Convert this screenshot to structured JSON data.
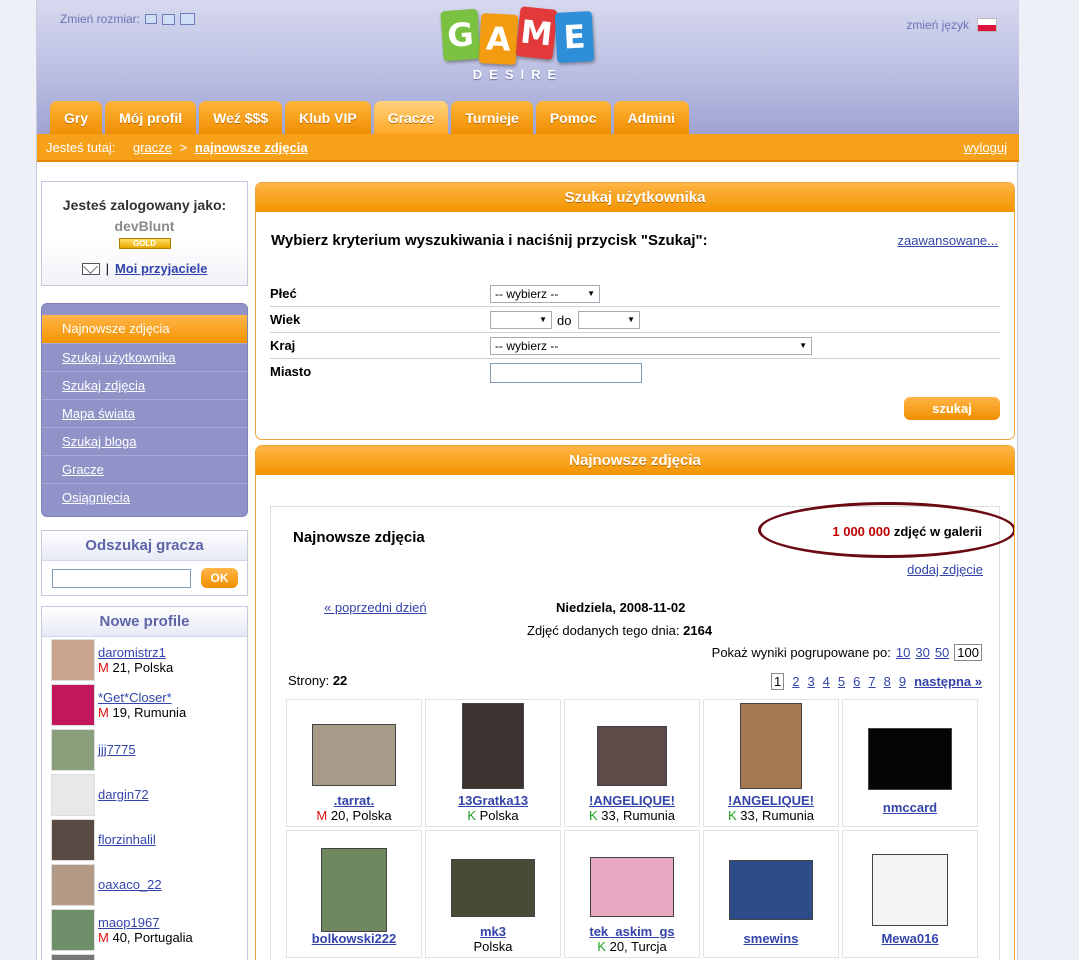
{
  "header": {
    "resize_label": "Zmień rozmiar:",
    "lang_label": "zmień język",
    "logo_letters": [
      "G",
      "A",
      "M",
      "E"
    ],
    "logo_colors": [
      "#7ac142",
      "#f39c12",
      "#e23a3a",
      "#2e8fd8"
    ],
    "logo_sub": "DESIRE"
  },
  "nav": {
    "tabs": [
      {
        "label": "Gry"
      },
      {
        "label": "Mój profil"
      },
      {
        "label": "Weź $$$"
      },
      {
        "label": "Klub VIP"
      },
      {
        "label": "Gracze",
        "active": true
      },
      {
        "label": "Turnieje"
      },
      {
        "label": "Pomoc"
      },
      {
        "label": "Admini"
      }
    ]
  },
  "breadcrumb": {
    "prefix": "Jesteś tutaj:",
    "parent": "gracze",
    "separator": ">",
    "current": "najnowsze zdjęcia",
    "logout": "wyloguj"
  },
  "login": {
    "label": "Jesteś zalogowany jako:",
    "nick": "devBlunt",
    "badge": "GOLD",
    "divider": "|",
    "friends": "Moi przyjaciele"
  },
  "menu": {
    "items": [
      {
        "label": "Najnowsze zdjęcia",
        "active": true
      },
      {
        "label": "Szukaj użytkownika"
      },
      {
        "label": "Szukaj zdjęcia"
      },
      {
        "label": "Mapa świata"
      },
      {
        "label": "Szukaj bloga"
      },
      {
        "label": "Gracze"
      },
      {
        "label": "Osiągnięcia"
      }
    ]
  },
  "find": {
    "title": "Odszukaj gracza",
    "value": "",
    "button": "OK"
  },
  "new_profiles": {
    "title": "Nowe profile",
    "items": [
      {
        "name": "daromistrz1",
        "sex": "M",
        "info": "21, Polska",
        "avatar_color": "#c9a38c"
      },
      {
        "name": "*Get*Closer*",
        "sex": "M",
        "info": "19, Rumunia",
        "avatar_color": "#c2185b"
      },
      {
        "name": "jjj7775",
        "sex": "",
        "info": "",
        "avatar_color": "#8aa07c"
      },
      {
        "name": "dargin72",
        "sex": "",
        "info": "",
        "avatar_color": "#e8e8e8"
      },
      {
        "name": "florzinhalil",
        "sex": "",
        "info": "",
        "avatar_color": "#5a4a44"
      },
      {
        "name": "oaxaco_22",
        "sex": "",
        "info": "",
        "avatar_color": "#b29a86"
      },
      {
        "name": "maop1967",
        "sex": "M",
        "info": "40, Portugalia",
        "avatar_color": "#6f8f6a"
      },
      {
        "name": "",
        "sex": "",
        "info": "",
        "avatar_color": "#777777"
      }
    ]
  },
  "search": {
    "header": "Szukaj użytkownika",
    "title": "Wybierz kryterium wyszukiwania i naciśnij przycisk \"Szukaj\":",
    "advanced": "zaawansowane...",
    "gender_label": "Płeć",
    "gender_value": "-- wybierz --",
    "age_label": "Wiek",
    "age_from": "",
    "age_to_label": "do",
    "age_to": "",
    "country_label": "Kraj",
    "country_value": "-- wybierz --",
    "city_label": "Miasto",
    "city_value": "",
    "button": "szukaj"
  },
  "photos": {
    "header": "Najnowsze zdjęcia",
    "title": "Najnowsze zdjęcia",
    "count_number": "1 000 000",
    "count_suffix": "zdjęć w galerii",
    "add_link": "dodaj zdjęcie",
    "prev_day": "« poprzedni dzień",
    "date": "Niedziela, 2008-11-02",
    "added_label": "Zdjęć dodanych tego dnia:",
    "added_value": "2164",
    "group_label": "Pokaż wyniki pogrupowane po:",
    "group_options": [
      "10",
      "30",
      "50"
    ],
    "group_selected": "100",
    "pages_label": "Strony:",
    "pages_total": "22",
    "page_current": "1",
    "page_links": [
      "2",
      "3",
      "4",
      "5",
      "6",
      "7",
      "8",
      "9"
    ],
    "next": "następna »",
    "items": [
      {
        "name": ".tarrat.",
        "sex": "M",
        "info": "20, Polska",
        "color": "#a89a88"
      },
      {
        "name": "13Gratka13",
        "sex": "K",
        "info": "Polska",
        "color": "#3d3432"
      },
      {
        "name": "!ANGELIQUE!",
        "sex": "K",
        "info": "33, Rumunia",
        "color": "#5e4a48"
      },
      {
        "name": "!ANGELIQUE!",
        "sex": "K",
        "info": "33, Rumunia",
        "color": "#a47a52"
      },
      {
        "name": "nmccard",
        "sex": "",
        "info": "",
        "color": "#050505"
      },
      {
        "name": "bolkowski222",
        "sex": "",
        "info": "",
        "color": "#708860"
      },
      {
        "name": "mk3",
        "sex": "",
        "info": "Polska",
        "color": "#4a4a38"
      },
      {
        "name": "tek_askim_gs",
        "sex": "K",
        "info": "20, Turcja",
        "color": "#e6a8c0"
      },
      {
        "name": "smewins",
        "sex": "",
        "info": "",
        "color": "#2c4d8a"
      },
      {
        "name": "Mewa016",
        "sex": "",
        "info": "",
        "color": "#f4f4f4"
      }
    ]
  }
}
